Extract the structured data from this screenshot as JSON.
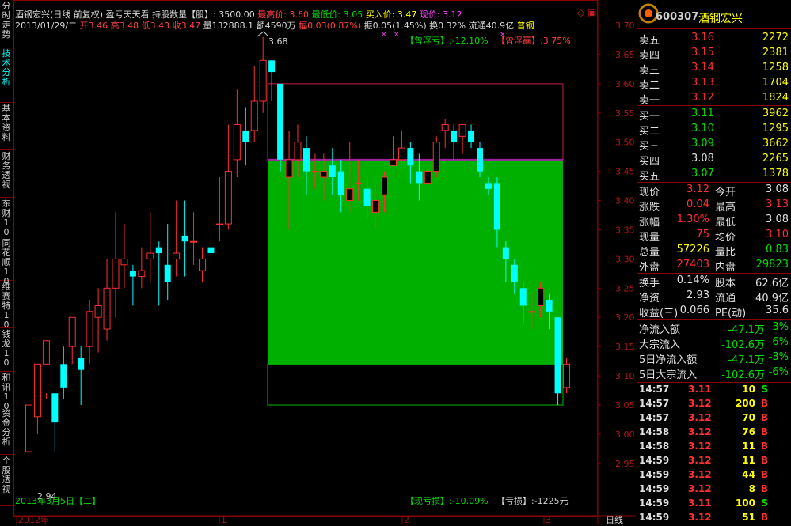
{
  "side_tabs": [
    {
      "label": "分时走势",
      "active": false
    },
    {
      "label": "技术分析",
      "active": true
    },
    {
      "label": "基本资料",
      "active": false
    },
    {
      "label": "财务透视",
      "active": false
    },
    {
      "label": "东财10",
      "active": false
    },
    {
      "label": "同花顺10",
      "active": false
    },
    {
      "label": "维赛特10",
      "active": false
    },
    {
      "label": "钱龙10",
      "active": false
    },
    {
      "label": "和讯10",
      "active": false
    },
    {
      "label": "资金分析",
      "active": false
    },
    {
      "label": "个股透视",
      "active": false
    }
  ],
  "info": {
    "line1": {
      "stock": "酒钢宏兴(日线 前复权)",
      "mode": "盈亏天天看",
      "holding_label": "持股数量【股】",
      "holding_value": ": 3500.00",
      "high_label": "最高价",
      "high_value": ": 3.60",
      "low_label": "最低价",
      "low_value": ": 3.05",
      "buy_label": "买入价",
      "buy_value": ": 3.47",
      "now_label": "现价",
      "now_value": ": 3.12"
    },
    "line2": {
      "date": "2013/01/29/二",
      "open": "开3.46",
      "high": "高3.48",
      "low": "低3.43",
      "close": "收3.47",
      "vol": "量132888.1",
      "amount": "额4590万",
      "change": "幅0.03(0.87%)",
      "amp": "振0.05(1.45%)",
      "turnover": "换0.32%",
      "float": "流通40.9亿",
      "sector": "普钢"
    }
  },
  "chart": {
    "peak_label": "3.68",
    "low_label": "2.94",
    "date_label": "2013年3月5日【二】",
    "float_loss": "【曾浮亏】:-12.10%",
    "float_gain": "【曾浮赢】:3.75%",
    "current_loss": "【现亏损】:-10.09%",
    "loss_amount": "【亏损】:-1225元",
    "x_axis": [
      "2012年",
      "1",
      "2",
      "3"
    ],
    "period_label": "日线"
  },
  "chart_data": {
    "type": "candlestick",
    "ylim": [
      3.0,
      3.7
    ],
    "yticks": [
      "3.70",
      "3.65",
      "3.60",
      "3.55",
      "3.50",
      "3.45",
      "3.40",
      "3.35",
      "3.30",
      "3.25",
      "3.20",
      "3.15",
      "3.10",
      "3.05",
      "3.00",
      "2.95"
    ],
    "candles": [
      [
        2.97,
        3.05,
        2.95,
        3.0
      ],
      [
        3.03,
        3.12,
        3.0,
        3.1
      ],
      [
        3.12,
        3.16,
        3.06,
        3.07
      ],
      [
        3.07,
        3.02,
        2.97,
        3.05
      ],
      [
        3.12,
        3.08,
        3.06,
        3.15
      ],
      [
        3.15,
        3.2,
        3.12,
        3.18
      ],
      [
        3.13,
        3.11,
        3.05,
        3.15
      ],
      [
        3.15,
        3.21,
        3.12,
        3.23
      ],
      [
        3.2,
        3.22,
        3.14,
        3.25
      ],
      [
        3.18,
        3.25,
        3.16,
        3.3
      ],
      [
        3.25,
        3.3,
        3.2,
        3.38
      ],
      [
        3.29,
        3.3,
        3.25,
        3.36
      ],
      [
        3.28,
        3.27,
        3.22,
        3.29
      ],
      [
        3.27,
        3.28,
        3.25,
        3.32
      ],
      [
        3.3,
        3.31,
        3.26,
        3.38
      ],
      [
        3.32,
        3.31,
        3.22,
        3.33
      ],
      [
        3.29,
        3.26,
        3.23,
        3.36
      ],
      [
        3.3,
        3.31,
        3.27,
        3.4
      ],
      [
        3.34,
        3.33,
        3.27,
        3.4
      ],
      [
        3.33,
        3.33,
        3.29,
        3.38
      ],
      [
        3.28,
        3.3,
        3.26,
        3.32
      ],
      [
        3.32,
        3.31,
        3.29,
        3.36
      ],
      [
        3.36,
        3.36,
        3.33,
        3.44
      ],
      [
        3.36,
        3.45,
        3.35,
        3.53
      ],
      [
        3.47,
        3.53,
        3.44,
        3.59
      ],
      [
        3.52,
        3.5,
        3.46,
        3.56
      ],
      [
        3.52,
        3.57,
        3.5,
        3.63
      ],
      [
        3.57,
        3.64,
        3.55,
        3.68
      ],
      [
        3.64,
        3.62,
        3.57,
        3.64
      ],
      [
        3.6,
        3.47,
        3.45,
        3.6
      ],
      [
        3.44,
        3.47,
        3.35,
        3.52
      ],
      [
        3.47,
        3.5,
        3.44,
        3.53
      ],
      [
        3.49,
        3.45,
        3.41,
        3.51
      ],
      [
        3.45,
        3.45,
        3.42,
        3.48
      ],
      [
        3.44,
        3.45,
        3.4,
        3.48
      ],
      [
        3.46,
        3.44,
        3.41,
        3.49
      ],
      [
        3.45,
        3.41,
        3.38,
        3.47
      ],
      [
        3.4,
        3.42,
        3.38,
        3.5
      ],
      [
        3.43,
        3.43,
        3.4,
        3.47
      ],
      [
        3.42,
        3.39,
        3.37,
        3.44
      ],
      [
        3.38,
        3.4,
        3.35,
        3.43
      ],
      [
        3.41,
        3.44,
        3.38,
        3.45
      ],
      [
        3.46,
        3.47,
        3.43,
        3.51
      ],
      [
        3.47,
        3.49,
        3.45,
        3.52
      ],
      [
        3.49,
        3.46,
        3.43,
        3.5
      ],
      [
        3.45,
        3.43,
        3.4,
        3.48
      ],
      [
        3.43,
        3.45,
        3.4,
        3.47
      ],
      [
        3.45,
        3.5,
        3.44,
        3.51
      ],
      [
        3.52,
        3.53,
        3.49,
        3.54
      ],
      [
        3.52,
        3.5,
        3.47,
        3.53
      ],
      [
        3.51,
        3.53,
        3.48,
        3.53
      ],
      [
        3.52,
        3.5,
        3.49,
        3.53
      ],
      [
        3.49,
        3.45,
        3.44,
        3.5
      ],
      [
        3.43,
        3.42,
        3.41,
        3.44
      ],
      [
        3.43,
        3.35,
        3.32,
        3.44
      ],
      [
        3.32,
        3.3,
        3.26,
        3.33
      ],
      [
        3.29,
        3.26,
        3.24,
        3.3
      ],
      [
        3.25,
        3.22,
        3.19,
        3.26
      ],
      [
        3.21,
        3.21,
        3.18,
        3.24
      ],
      [
        3.22,
        3.25,
        3.2,
        3.26
      ],
      [
        3.23,
        3.21,
        3.18,
        3.24
      ],
      [
        3.2,
        3.07,
        3.05,
        3.2
      ],
      [
        3.08,
        3.12,
        3.07,
        3.13
      ]
    ]
  },
  "right": {
    "code": "600307",
    "name": "酒钢宏兴",
    "asks": [
      {
        "label": "卖五",
        "price": "3.16",
        "vol": "2272"
      },
      {
        "label": "卖四",
        "price": "3.15",
        "vol": "2381"
      },
      {
        "label": "卖三",
        "price": "3.14",
        "vol": "1258"
      },
      {
        "label": "卖二",
        "price": "3.13",
        "vol": "1704"
      },
      {
        "label": "卖一",
        "price": "3.12",
        "vol": "1824"
      }
    ],
    "bids": [
      {
        "label": "买一",
        "price": "3.11",
        "vol": "3962",
        "pc": "g"
      },
      {
        "label": "买二",
        "price": "3.10",
        "vol": "1295",
        "pc": "g"
      },
      {
        "label": "买三",
        "price": "3.09",
        "vol": "3662",
        "pc": "g"
      },
      {
        "label": "买四",
        "price": "3.08",
        "vol": "2265",
        "pc": "w"
      },
      {
        "label": "买五",
        "price": "3.07",
        "vol": "1378",
        "pc": "g"
      }
    ],
    "quote": [
      {
        "l1": "现价",
        "v1": "3.12",
        "c1": "r",
        "l2": "今开",
        "v2": "3.08",
        "c2": "w"
      },
      {
        "l1": "涨跌",
        "v1": "0.04",
        "c1": "r",
        "l2": "最高",
        "v2": "3.13",
        "c2": "r"
      },
      {
        "l1": "涨幅",
        "v1": "1.30%",
        "c1": "r",
        "l2": "最低",
        "v2": "3.08",
        "c2": "w"
      },
      {
        "l1": "现量",
        "v1": "75",
        "c1": "r",
        "l2": "均价",
        "v2": "3.10",
        "c2": "r"
      },
      {
        "l1": "总量",
        "v1": "57226",
        "c1": "y",
        "l2": "量比",
        "v2": "0.83",
        "c2": "g"
      },
      {
        "l1": "外盘",
        "v1": "27403",
        "c1": "r",
        "l2": "内盘",
        "v2": "29823",
        "c2": "g"
      }
    ],
    "fund": [
      {
        "l1": "换手",
        "v1": "0.14%",
        "l2": "股本",
        "v2": "62.6亿"
      },
      {
        "l1": "净资",
        "v1": "2.93",
        "l2": "流通",
        "v2": "40.9亿"
      },
      {
        "l1": "收益(三)",
        "v1": "0.066",
        "l2": "PE(动)",
        "v2": "35.6"
      }
    ],
    "flow": [
      {
        "label": "净流入额",
        "amount": "-47.1万",
        "pct": "-3%"
      },
      {
        "label": "大宗流入",
        "amount": "-102.6万",
        "pct": "-6%"
      },
      {
        "label": "5日净流入额",
        "amount": "-47.1万",
        "pct": "-3%"
      },
      {
        "label": "5日大宗流入",
        "amount": "-102.6万",
        "pct": "-6%"
      }
    ],
    "ticks": [
      {
        "time": "14:57",
        "price": "3.11",
        "pc": "r",
        "vol": "10",
        "vc": "y",
        "side": "S",
        "sc": "g"
      },
      {
        "time": "14:57",
        "price": "3.12",
        "pc": "r",
        "vol": "200",
        "vc": "y",
        "side": "B",
        "sc": "r"
      },
      {
        "time": "14:57",
        "price": "3.12",
        "pc": "r",
        "vol": "70",
        "vc": "y",
        "side": "B",
        "sc": "r"
      },
      {
        "time": "14:58",
        "price": "3.12",
        "pc": "r",
        "vol": "76",
        "vc": "y",
        "side": "B",
        "sc": "r"
      },
      {
        "time": "14:58",
        "price": "3.12",
        "pc": "r",
        "vol": "11",
        "vc": "y",
        "side": "B",
        "sc": "r"
      },
      {
        "time": "14:59",
        "price": "3.12",
        "pc": "r",
        "vol": "11",
        "vc": "y",
        "side": "B",
        "sc": "r"
      },
      {
        "time": "14:59",
        "price": "3.12",
        "pc": "r",
        "vol": "44",
        "vc": "y",
        "side": "B",
        "sc": "r"
      },
      {
        "time": "14:59",
        "price": "3.12",
        "pc": "r",
        "vol": "8",
        "vc": "y",
        "side": "B",
        "sc": "r"
      },
      {
        "time": "14:59",
        "price": "3.11",
        "pc": "r",
        "vol": "100",
        "vc": "y",
        "side": "S",
        "sc": "g"
      },
      {
        "time": "14:59",
        "price": "3.12",
        "pc": "r",
        "vol": "51",
        "vc": "y",
        "side": "B",
        "sc": "r"
      }
    ]
  },
  "colors": {
    "up": "#ff3030",
    "down": "#00ffff",
    "fill": "#00b000",
    "grid": "#8b0000"
  }
}
